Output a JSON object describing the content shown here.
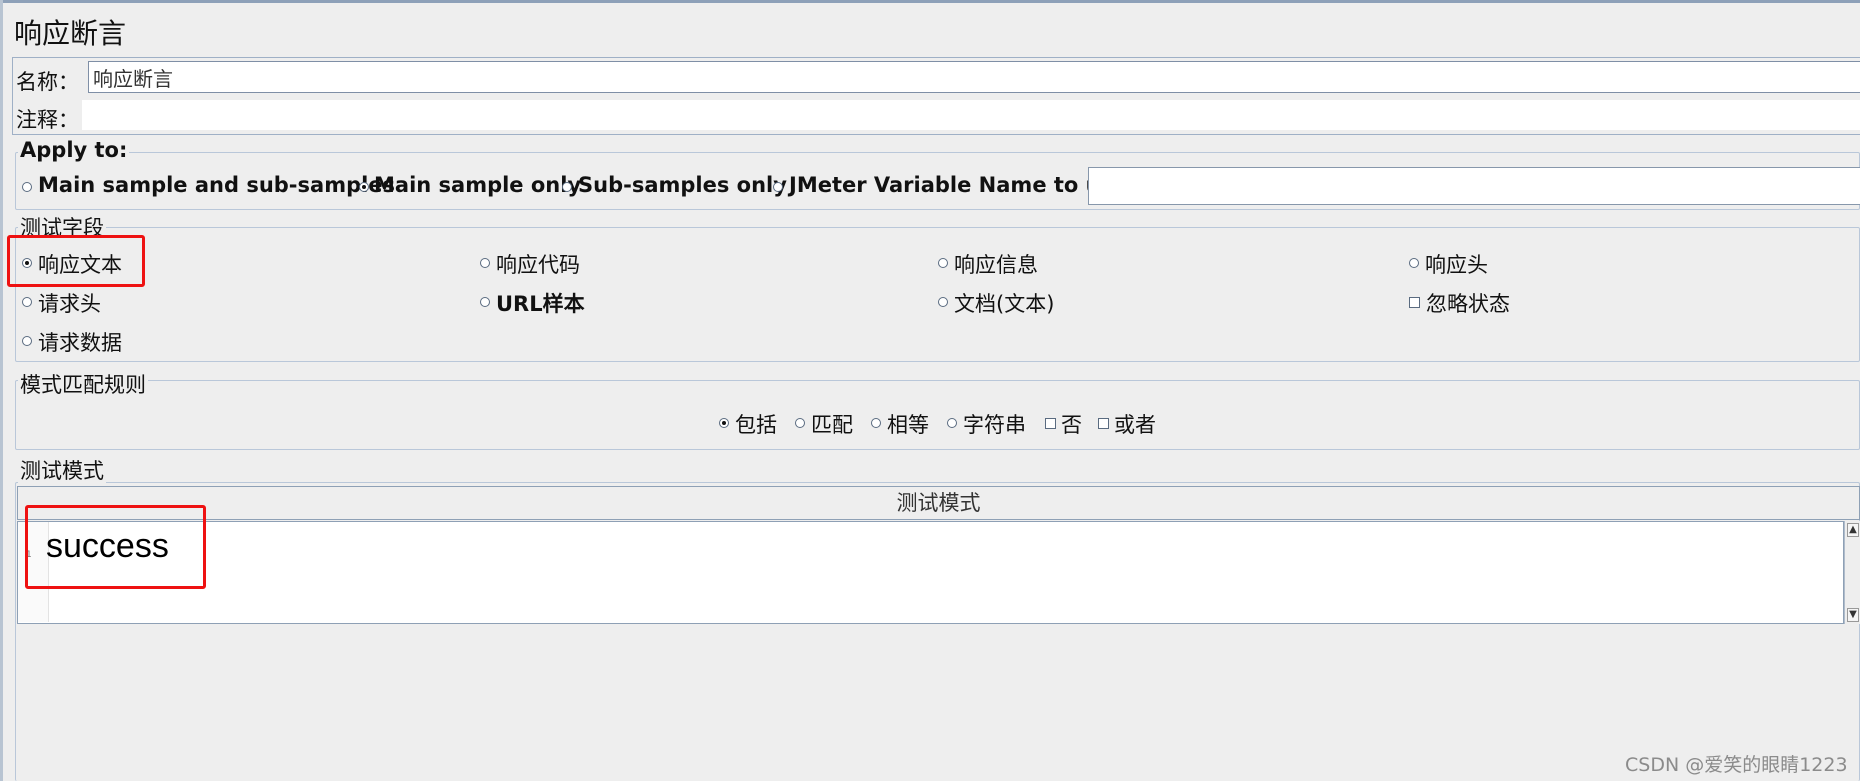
{
  "title": "响应断言",
  "name_label": "名称：",
  "name_value": "响应断言",
  "comment_label": "注释：",
  "apply_to": {
    "legend": "Apply to:",
    "options": [
      {
        "label": "Main sample and sub-samples",
        "selected": false
      },
      {
        "label": "Main sample only",
        "selected": true
      },
      {
        "label": "Sub-samples only",
        "selected": false
      },
      {
        "label": "JMeter Variable Name to use",
        "selected": false
      }
    ]
  },
  "test_fields": {
    "legend": "测试字段",
    "options": [
      {
        "label": "响应文本",
        "selected": true
      },
      {
        "label": "响应代码",
        "selected": false
      },
      {
        "label": "响应信息",
        "selected": false
      },
      {
        "label": "响应头",
        "selected": false
      },
      {
        "label": "请求头",
        "selected": false
      },
      {
        "label": "URL样本",
        "selected": false
      },
      {
        "label": "文档(文本)",
        "selected": false
      },
      {
        "label": "忽略状态",
        "selected": false
      },
      {
        "label": "请求数据",
        "selected": false
      }
    ]
  },
  "pattern_rules": {
    "legend": "模式匹配规则",
    "options": [
      {
        "label": "包括",
        "selected": true
      },
      {
        "label": "匹配",
        "selected": false
      },
      {
        "label": "相等",
        "selected": false
      },
      {
        "label": "字符串",
        "selected": false
      },
      {
        "label": "否",
        "selected": false
      },
      {
        "label": "或者",
        "selected": false
      }
    ]
  },
  "test_patterns": {
    "legend": "测试模式",
    "column_header": "测试模式",
    "rows": [
      {
        "line_number": "1",
        "value": "success"
      }
    ]
  },
  "watermark": "CSDN @爱笑的眼睛1223",
  "accent_color": "#ee1111"
}
